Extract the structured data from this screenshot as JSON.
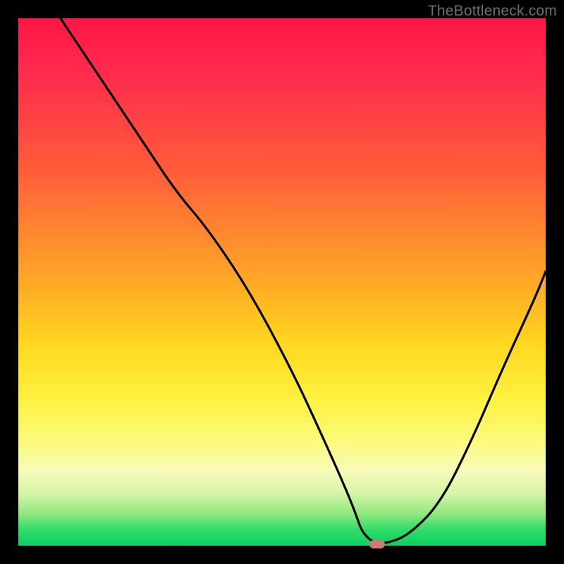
{
  "watermark": "TheBottleneck.com",
  "chart_data": {
    "type": "line",
    "title": "",
    "xlabel": "",
    "ylabel": "",
    "xlim": [
      0,
      100
    ],
    "ylim": [
      0,
      100
    ],
    "series": [
      {
        "name": "curve",
        "x": [
          8,
          16,
          24,
          30,
          36,
          44,
          52,
          58,
          62,
          64,
          65,
          66.5,
          68,
          70,
          74,
          80,
          86,
          92,
          98,
          100
        ],
        "y": [
          100,
          88,
          76,
          67,
          60,
          48,
          33,
          20,
          11,
          6,
          3,
          1.2,
          0.5,
          0.5,
          2,
          8,
          20,
          34,
          47,
          52
        ]
      }
    ],
    "marker": {
      "x": 68,
      "y": 0.3
    },
    "gradient_stops": [
      {
        "pos": 0,
        "color": "#ff1744"
      },
      {
        "pos": 50,
        "color": "#ffc020"
      },
      {
        "pos": 80,
        "color": "#fff060"
      },
      {
        "pos": 100,
        "color": "#0fce62"
      }
    ]
  }
}
